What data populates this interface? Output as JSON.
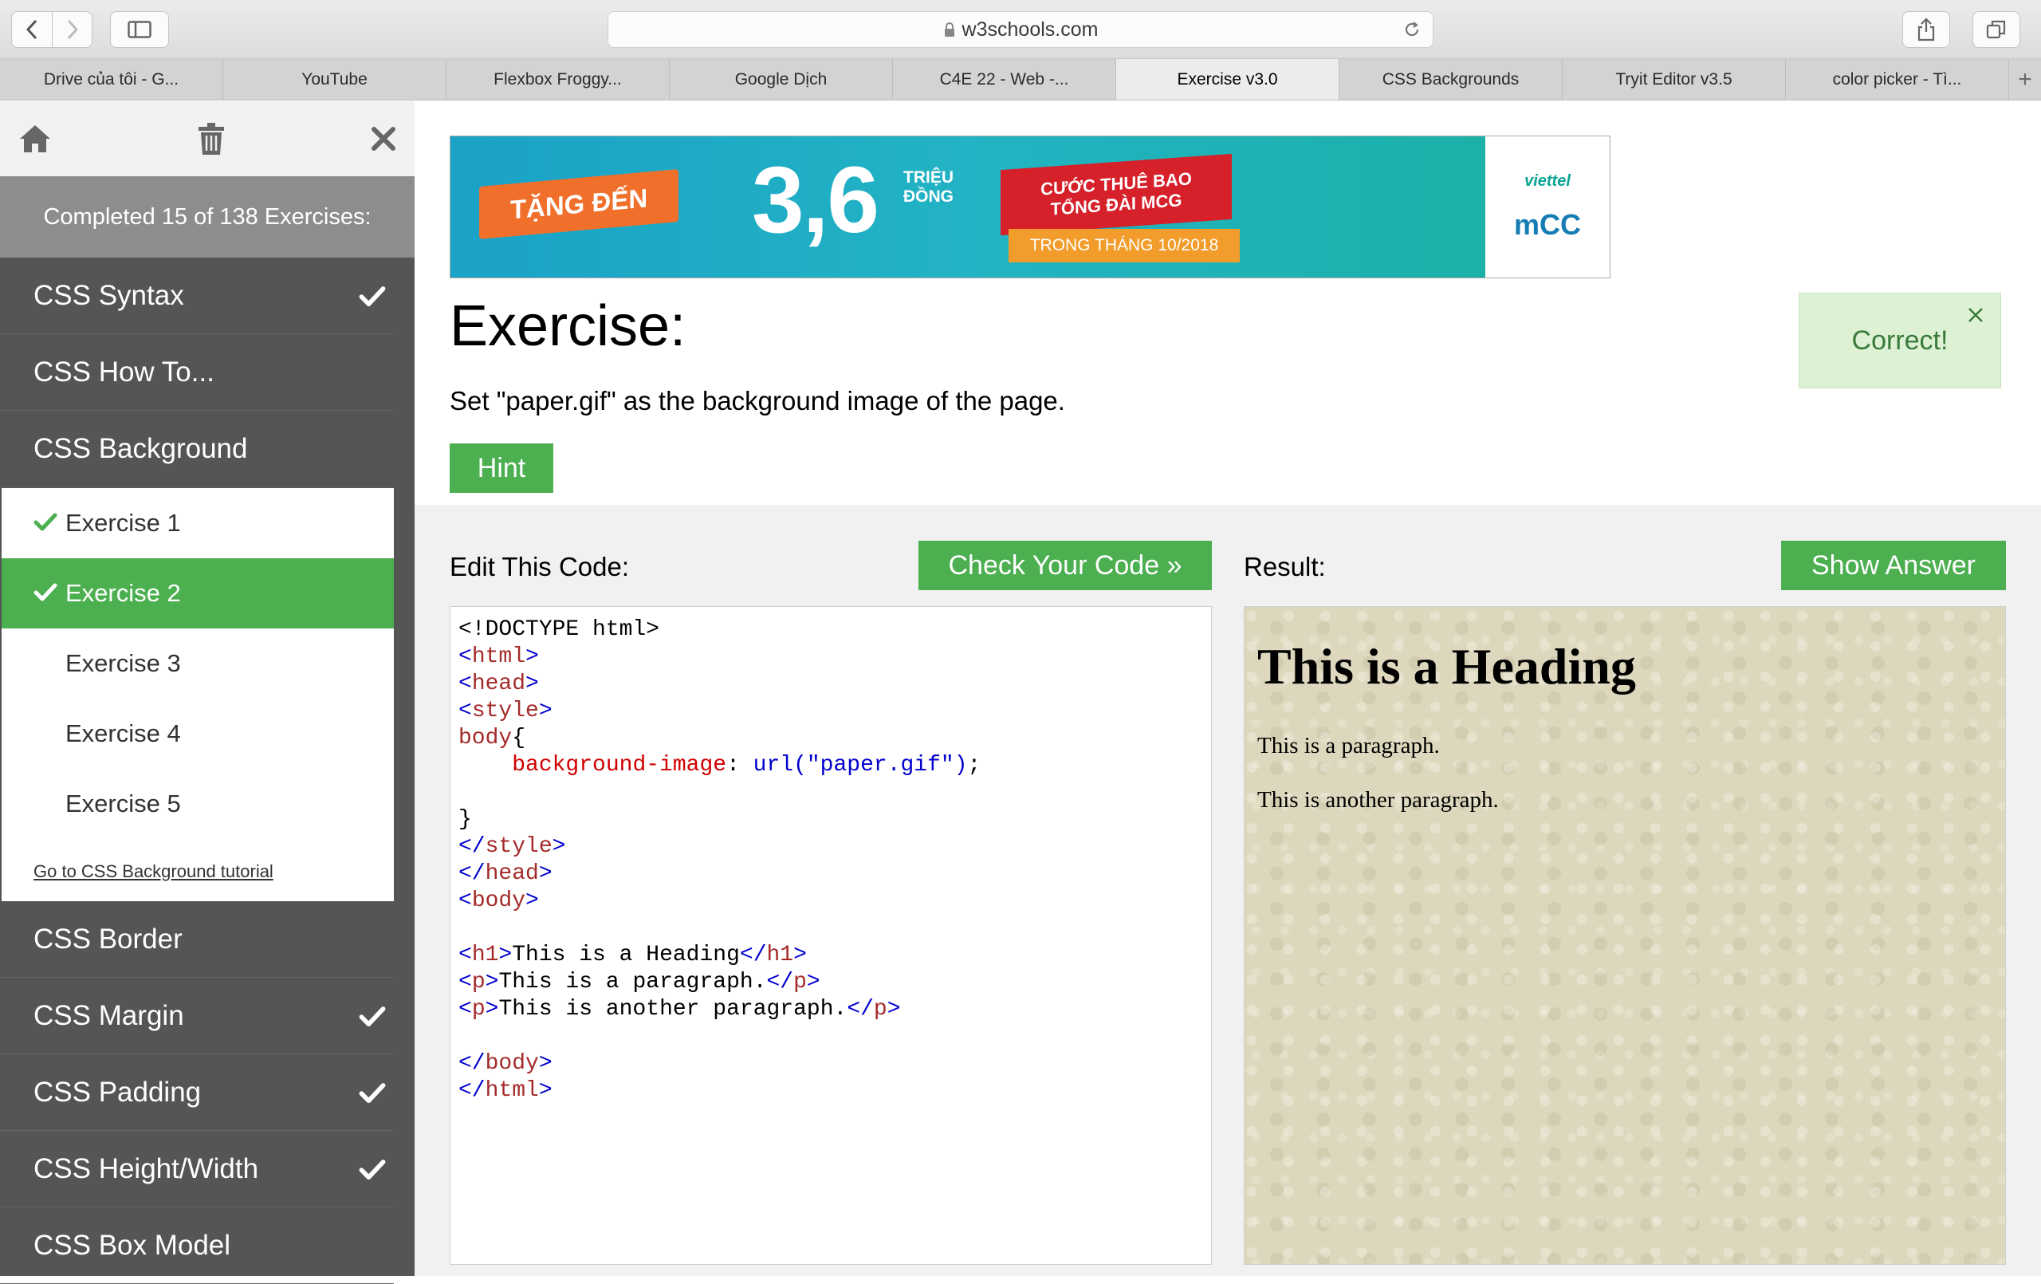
{
  "browser": {
    "url": "w3schools.com",
    "tabs": [
      {
        "label": "Drive của tôi - G..."
      },
      {
        "label": "YouTube"
      },
      {
        "label": "Flexbox Froggy..."
      },
      {
        "label": "Google Dịch"
      },
      {
        "label": "C4E 22 - Web -..."
      },
      {
        "label": "Exercise v3.0"
      },
      {
        "label": "CSS Backgrounds"
      },
      {
        "label": "Tryit Editor v3.5"
      },
      {
        "label": "color picker - Tì..."
      }
    ],
    "active_tab": 5,
    "new_tab_symbol": "+"
  },
  "sidebar": {
    "icons": [
      "home-icon",
      "trash-icon",
      "close-icon"
    ],
    "progress_text": "Completed 15 of 138 Exercises:",
    "lessons_top": [
      {
        "label": "CSS Syntax",
        "completed": true
      },
      {
        "label": "CSS How To...",
        "completed": false
      },
      {
        "label": "CSS Background",
        "completed": false
      }
    ],
    "exercises": [
      {
        "label": "Exercise 1",
        "completed": true,
        "active": false
      },
      {
        "label": "Exercise 2",
        "completed": true,
        "active": true
      },
      {
        "label": "Exercise 3",
        "completed": false,
        "active": false
      },
      {
        "label": "Exercise 4",
        "completed": false,
        "active": false
      },
      {
        "label": "Exercise 5",
        "completed": false,
        "active": false
      }
    ],
    "tutorial_link": "Go to CSS Background tutorial",
    "lessons_bottom": [
      {
        "label": "CSS Border",
        "completed": false
      },
      {
        "label": "CSS Margin",
        "completed": true
      },
      {
        "label": "CSS Padding",
        "completed": true
      },
      {
        "label": "CSS Height/Width",
        "completed": true
      },
      {
        "label": "CSS Box Model",
        "completed": false
      }
    ]
  },
  "ad": {
    "ribbon1": "TẶNG ĐẾN",
    "amount": "3,6",
    "unit_line1": "TRIỆU",
    "unit_line2": "ĐỒNG",
    "ribbon2_line1": "CƯỚC THUÊ BAO",
    "ribbon2_line2": "TỔNG ĐÀI MCG",
    "ribbon3": "TRONG THÁNG 10/2018",
    "brand1": "viettel",
    "brand2": "mCC"
  },
  "exercise": {
    "title": "Exercise:",
    "instruction": "Set \"paper.gif\" as the background image of the page.",
    "hint_label": "Hint",
    "status": "Correct!",
    "edit_label": "Edit This Code:",
    "check_label": "Check Your Code »",
    "result_label": "Result:",
    "answer_label": "Show Answer"
  },
  "code_lines": [
    [
      {
        "t": "<!DOCTYPE html>",
        "c": "plain"
      }
    ],
    [
      {
        "t": "<",
        "c": "brack"
      },
      {
        "t": "html",
        "c": "tag"
      },
      {
        "t": ">",
        "c": "brack"
      }
    ],
    [
      {
        "t": "<",
        "c": "brack"
      },
      {
        "t": "head",
        "c": "tag"
      },
      {
        "t": ">",
        "c": "brack"
      }
    ],
    [
      {
        "t": "<",
        "c": "brack"
      },
      {
        "t": "style",
        "c": "tag"
      },
      {
        "t": ">",
        "c": "brack"
      }
    ],
    [
      {
        "t": "body",
        "c": "tag"
      },
      {
        "t": "{",
        "c": "plain"
      }
    ],
    [
      {
        "t": "    ",
        "c": "plain"
      },
      {
        "t": "background-image",
        "c": "prop"
      },
      {
        "t": ": ",
        "c": "plain"
      },
      {
        "t": "url(\"paper.gif\")",
        "c": "val"
      },
      {
        "t": ";",
        "c": "plain"
      }
    ],
    [],
    [
      {
        "t": "}",
        "c": "plain"
      }
    ],
    [
      {
        "t": "</",
        "c": "brack"
      },
      {
        "t": "style",
        "c": "tag"
      },
      {
        "t": ">",
        "c": "brack"
      }
    ],
    [
      {
        "t": "</",
        "c": "brack"
      },
      {
        "t": "head",
        "c": "tag"
      },
      {
        "t": ">",
        "c": "brack"
      }
    ],
    [
      {
        "t": "<",
        "c": "brack"
      },
      {
        "t": "body",
        "c": "tag"
      },
      {
        "t": ">",
        "c": "brack"
      }
    ],
    [],
    [
      {
        "t": "<",
        "c": "brack"
      },
      {
        "t": "h1",
        "c": "tag"
      },
      {
        "t": ">",
        "c": "brack"
      },
      {
        "t": "This is a Heading",
        "c": "plain"
      },
      {
        "t": "</",
        "c": "brack"
      },
      {
        "t": "h1",
        "c": "tag"
      },
      {
        "t": ">",
        "c": "brack"
      }
    ],
    [
      {
        "t": "<",
        "c": "brack"
      },
      {
        "t": "p",
        "c": "tag"
      },
      {
        "t": ">",
        "c": "brack"
      },
      {
        "t": "This is a paragraph.",
        "c": "plain"
      },
      {
        "t": "</",
        "c": "brack"
      },
      {
        "t": "p",
        "c": "tag"
      },
      {
        "t": ">",
        "c": "brack"
      }
    ],
    [
      {
        "t": "<",
        "c": "brack"
      },
      {
        "t": "p",
        "c": "tag"
      },
      {
        "t": ">",
        "c": "brack"
      },
      {
        "t": "This is another paragraph.",
        "c": "plain"
      },
      {
        "t": "</",
        "c": "brack"
      },
      {
        "t": "p",
        "c": "tag"
      },
      {
        "t": ">",
        "c": "brack"
      }
    ],
    [],
    [
      {
        "t": "</",
        "c": "brack"
      },
      {
        "t": "body",
        "c": "tag"
      },
      {
        "t": ">",
        "c": "brack"
      }
    ],
    [
      {
        "t": "</",
        "c": "brack"
      },
      {
        "t": "html",
        "c": "tag"
      },
      {
        "t": ">",
        "c": "brack"
      }
    ]
  ],
  "result": {
    "heading": "This is a Heading",
    "p1": "This is a paragraph.",
    "p2": "This is another paragraph."
  },
  "colors": {
    "accent_green": "#4caf50",
    "sidebar_dark": "#555555",
    "correct_bg": "#ddf1d4"
  }
}
